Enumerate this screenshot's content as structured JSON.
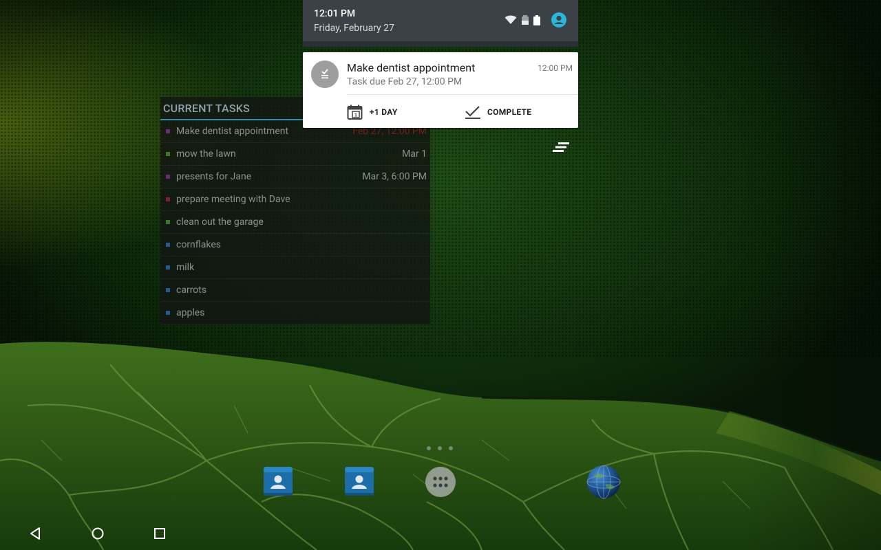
{
  "widget": {
    "title": "CURRENT TASKS",
    "tasks": [
      {
        "name": "Make dentist appointment",
        "date": "Feb 27, 12:00 PM",
        "color": "#6b2a7a",
        "overdue": true
      },
      {
        "name": "mow the lawn",
        "date": "Mar 1",
        "color": "#3c7a22"
      },
      {
        "name": "presents for Jane",
        "date": "Mar 3, 6:00 PM",
        "color": "#6b2a7a"
      },
      {
        "name": "prepare meeting with Dave",
        "date": "",
        "color": "#7a1f3c"
      },
      {
        "name": "clean out the garage",
        "date": "",
        "color": "#3c7a22"
      },
      {
        "name": "cornflakes",
        "date": "",
        "color": "#1f5f8f"
      },
      {
        "name": "milk",
        "date": "",
        "color": "#1f5f8f"
      },
      {
        "name": "carrots",
        "date": "",
        "color": "#1f5f8f"
      },
      {
        "name": "apples",
        "date": "",
        "color": "#1f5f8f"
      }
    ]
  },
  "status_bar": {
    "time": "12:01 PM",
    "date": "Friday, February 27",
    "icons": [
      "wifi-icon",
      "signal-icon",
      "battery-icon",
      "account-icon"
    ],
    "account_color": "#29b6d8"
  },
  "notification": {
    "title": "Make dentist appointment",
    "time": "12:00 PM",
    "subtitle": "Task due Feb 27, 12:00 PM",
    "actions": [
      {
        "label": "+1 DAY",
        "icon": "calendar-plus-icon"
      },
      {
        "label": "COMPLETE",
        "icon": "checkmark-icon"
      }
    ]
  },
  "home": {
    "page_count": 3,
    "apps": [
      "contacts-icon",
      "contacts-icon",
      "app-drawer-icon",
      "browser-globe-icon"
    ]
  },
  "navigation": [
    "back-icon",
    "home-icon",
    "recents-icon"
  ]
}
